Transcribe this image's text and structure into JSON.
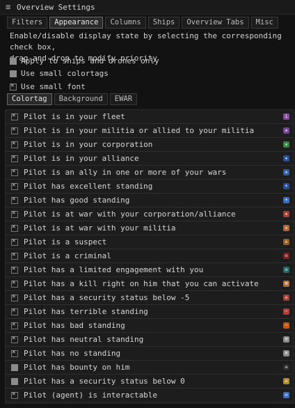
{
  "window": {
    "title": "Overview Settings"
  },
  "top_tabs": [
    "Filters",
    "Appearance",
    "Columns",
    "Ships",
    "Overview Tabs",
    "Misc"
  ],
  "active_top_tab": "Appearance",
  "description_lines": [
    "Enable/disable display state by selecting the corresponding check box,",
    "drag-and-drop to modify priority"
  ],
  "options": [
    {
      "label": "Apply to ships and drones only",
      "state": "filled"
    },
    {
      "label": "Use small colortags",
      "state": "filled"
    },
    {
      "label": "Use small font",
      "state": "checked"
    }
  ],
  "sub_tabs": [
    "Colortag",
    "Background",
    "EWAR"
  ],
  "active_sub_tab": "Colortag",
  "colortags": [
    {
      "label": "Pilot is in your fleet",
      "state": "checked",
      "icon": "purple-fleet-icon",
      "color": "#8e44ad",
      "glyph": "i"
    },
    {
      "label": "Pilot is in your militia or allied to your militia",
      "state": "checked",
      "icon": "purple-star-icon",
      "color": "#7b3fa6",
      "glyph": "★"
    },
    {
      "label": "Pilot is in your corporation",
      "state": "checked",
      "icon": "green-star-icon",
      "color": "#2e8b3a",
      "glyph": "★"
    },
    {
      "label": "Pilot is in your alliance",
      "state": "checked",
      "icon": "blue-star-icon",
      "color": "#1f4fa8",
      "glyph": "★"
    },
    {
      "label": "Pilot is an ally in one or more of your wars",
      "state": "checked",
      "icon": "blue-star-icon",
      "color": "#2b5fb0",
      "glyph": "★"
    },
    {
      "label": "Pilot has excellent standing",
      "state": "checked",
      "icon": "blue-plus-icon",
      "color": "#1f4fa8",
      "glyph": "+"
    },
    {
      "label": "Pilot has good standing",
      "state": "checked",
      "icon": "light-blue-plus-icon",
      "color": "#2f6fd0",
      "glyph": "+"
    },
    {
      "label": "Pilot is at war with your corporation/alliance",
      "state": "checked",
      "icon": "red-star-icon",
      "color": "#b23a2a",
      "glyph": "★"
    },
    {
      "label": "Pilot is at war with your militia",
      "state": "checked",
      "icon": "orange-star-icon",
      "color": "#c0602a",
      "glyph": "★"
    },
    {
      "label": "Pilot is a suspect",
      "state": "checked",
      "icon": "orange-skull-icon",
      "color": "#9b5a1a",
      "glyph": "☠"
    },
    {
      "label": "Pilot is a criminal",
      "state": "checked",
      "icon": "red-skull-icon",
      "color": "#8b1a1a",
      "glyph": "☠"
    },
    {
      "label": "Pilot has a limited engagement with you",
      "state": "checked",
      "icon": "teal-skull-icon",
      "color": "#1a6b6b",
      "glyph": "☠"
    },
    {
      "label": "Pilot has a kill right on him that you can activate",
      "state": "checked",
      "icon": "orange-crosshair-icon",
      "color": "#c06a2a",
      "glyph": "⊞"
    },
    {
      "label": "Pilot has a security status below -5",
      "state": "checked",
      "icon": "red-skull-icon",
      "color": "#b23a2a",
      "glyph": "☠"
    },
    {
      "label": "Pilot has terrible standing",
      "state": "checked",
      "icon": "red-minus-icon",
      "color": "#c0392b",
      "glyph": "−"
    },
    {
      "label": "Pilot has bad standing",
      "state": "checked",
      "icon": "orange-minus-icon",
      "color": "#d35400",
      "glyph": "−"
    },
    {
      "label": "Pilot has neutral standing",
      "state": "checked",
      "icon": "grey-equals-icon",
      "color": "#8a8a8a",
      "glyph": "≡"
    },
    {
      "label": "Pilot has no standing",
      "state": "checked",
      "icon": "grey-equals-icon",
      "color": "#8a8a8a",
      "glyph": "≡"
    },
    {
      "label": "Pilot has bounty on him",
      "state": "filled",
      "icon": "white-skull-icon",
      "color": "#2a2a2a",
      "glyph": "☠"
    },
    {
      "label": "Pilot has a security status below 0",
      "state": "filled",
      "icon": "yellow-skull-icon",
      "color": "#b58a1a",
      "glyph": "☠"
    },
    {
      "label": "Pilot (agent) is interactable",
      "state": "checked",
      "icon": "blue-speech-icon",
      "color": "#2f6fd0",
      "glyph": "✉"
    }
  ]
}
